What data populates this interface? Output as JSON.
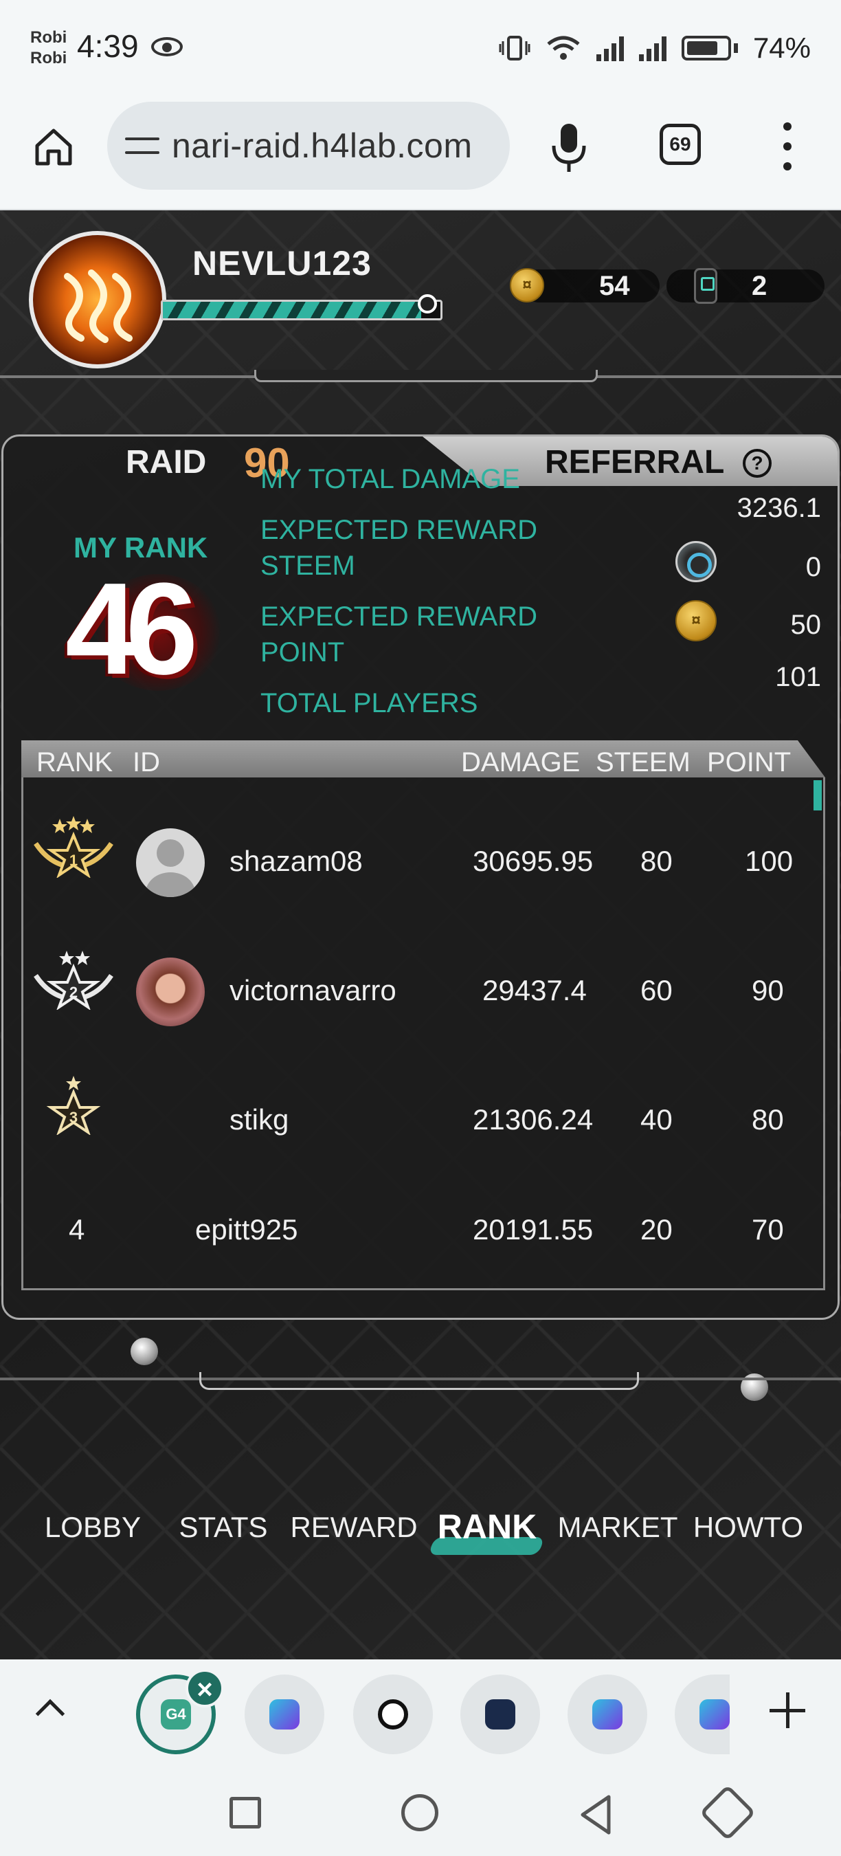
{
  "status_bar": {
    "carrier_line1": "Robi",
    "carrier_line2": "Robi",
    "time": "4:39",
    "battery": "74%"
  },
  "browser": {
    "url": "nari-raid.h4lab.com",
    "tab_count": "69"
  },
  "player": {
    "name": "NEVLU123",
    "xp_fraction": 0.93,
    "coins": "54",
    "tickets": "2"
  },
  "panel": {
    "tab_raid": "RAID",
    "raid_number": "90",
    "tab_referral": "REFERRAL",
    "my_rank_label": "MY RANK",
    "my_rank": "46",
    "stats": {
      "total_damage_label": "MY TOTAL DAMAGE",
      "total_damage": "3236.1",
      "reward_steem_label_1": "EXPECTED REWARD",
      "reward_steem_label_2": "STEEM",
      "reward_steem": "0",
      "reward_point_label_1": "EXPECTED REWARD",
      "reward_point_label_2": "POINT",
      "reward_point": "50",
      "total_players_label": "TOTAL PLAYERS",
      "total_players": "101"
    }
  },
  "table": {
    "headers": {
      "rank": "RANK",
      "id": "ID",
      "damage": "DAMAGE",
      "steem": "STEEM",
      "point": "POINT"
    },
    "rows": [
      {
        "rank": "1",
        "id": "shazam08",
        "damage": "30695.95",
        "steem": "80",
        "point": "100"
      },
      {
        "rank": "2",
        "id": "victornavarro",
        "damage": "29437.4",
        "steem": "60",
        "point": "90"
      },
      {
        "rank": "3",
        "id": "stikg",
        "damage": "21306.24",
        "steem": "40",
        "point": "80"
      },
      {
        "rank": "4",
        "id": "epitt925",
        "damage": "20191.55",
        "steem": "20",
        "point": "70"
      }
    ]
  },
  "game_nav": {
    "lobby": "LOBBY",
    "stats": "STATS",
    "reward": "REWARD",
    "rank": "RANK",
    "market": "MARKET",
    "howto": "HOWTO"
  },
  "tab_strip": {
    "active_tab_label": "G4"
  },
  "colors": {
    "accent_teal": "#2fb3a0",
    "raid_number": "#e8a25a",
    "panel_bg": "#1c1c1c"
  }
}
